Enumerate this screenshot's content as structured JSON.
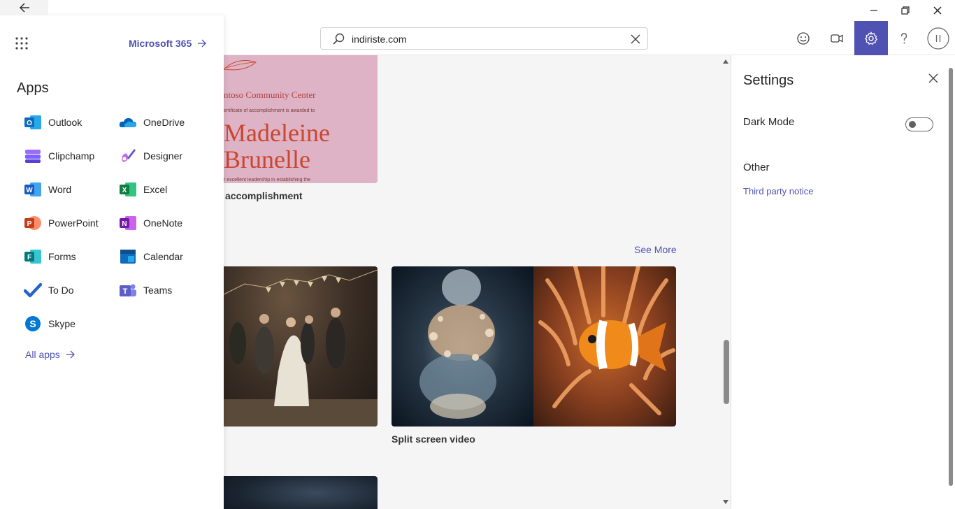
{
  "search": {
    "value": "indiriste.com"
  },
  "launcher": {
    "brand_link": "Microsoft 365",
    "section_title": "Apps",
    "apps": [
      {
        "label": "Outlook",
        "icon": "outlook-icon",
        "color": "#0f6cbd"
      },
      {
        "label": "OneDrive",
        "icon": "onedrive-icon",
        "color": "#0364b8"
      },
      {
        "label": "Clipchamp",
        "icon": "clipchamp-icon",
        "color": "#7b61ff"
      },
      {
        "label": "Designer",
        "icon": "designer-icon",
        "color": "#8a4fd6"
      },
      {
        "label": "Word",
        "icon": "word-icon",
        "color": "#185abd"
      },
      {
        "label": "Excel",
        "icon": "excel-icon",
        "color": "#107c41"
      },
      {
        "label": "PowerPoint",
        "icon": "powerpoint-icon",
        "color": "#c43e1c"
      },
      {
        "label": "OneNote",
        "icon": "onenote-icon",
        "color": "#7719aa"
      },
      {
        "label": "Forms",
        "icon": "forms-icon",
        "color": "#03787c"
      },
      {
        "label": "Calendar",
        "icon": "calendar-icon",
        "color": "#0f6cbd"
      },
      {
        "label": "To Do",
        "icon": "todo-icon",
        "color": "#2564cf"
      },
      {
        "label": "Teams",
        "icon": "teams-icon",
        "color": "#5b5fc7"
      },
      {
        "label": "Skype",
        "icon": "skype-icon",
        "color": "#0078d4"
      }
    ],
    "all_apps_link": "All apps"
  },
  "content": {
    "certificate": {
      "line1": "ntoso Community Center",
      "line2": "ertificate of accomplishment is awarded to",
      "line3": "Madeleine",
      "line4": "Brunelle",
      "line5": "r excellent leadership in establishing the",
      "caption": "accomplishment"
    },
    "see_more": "See More",
    "video_caption": "Split screen video"
  },
  "settings": {
    "title": "Settings",
    "dark_mode_label": "Dark Mode",
    "dark_mode_on": false,
    "other_heading": "Other",
    "third_party_link": "Third party notice"
  },
  "colors": {
    "accent": "#4f52b2",
    "background": "#f5f5f5"
  }
}
